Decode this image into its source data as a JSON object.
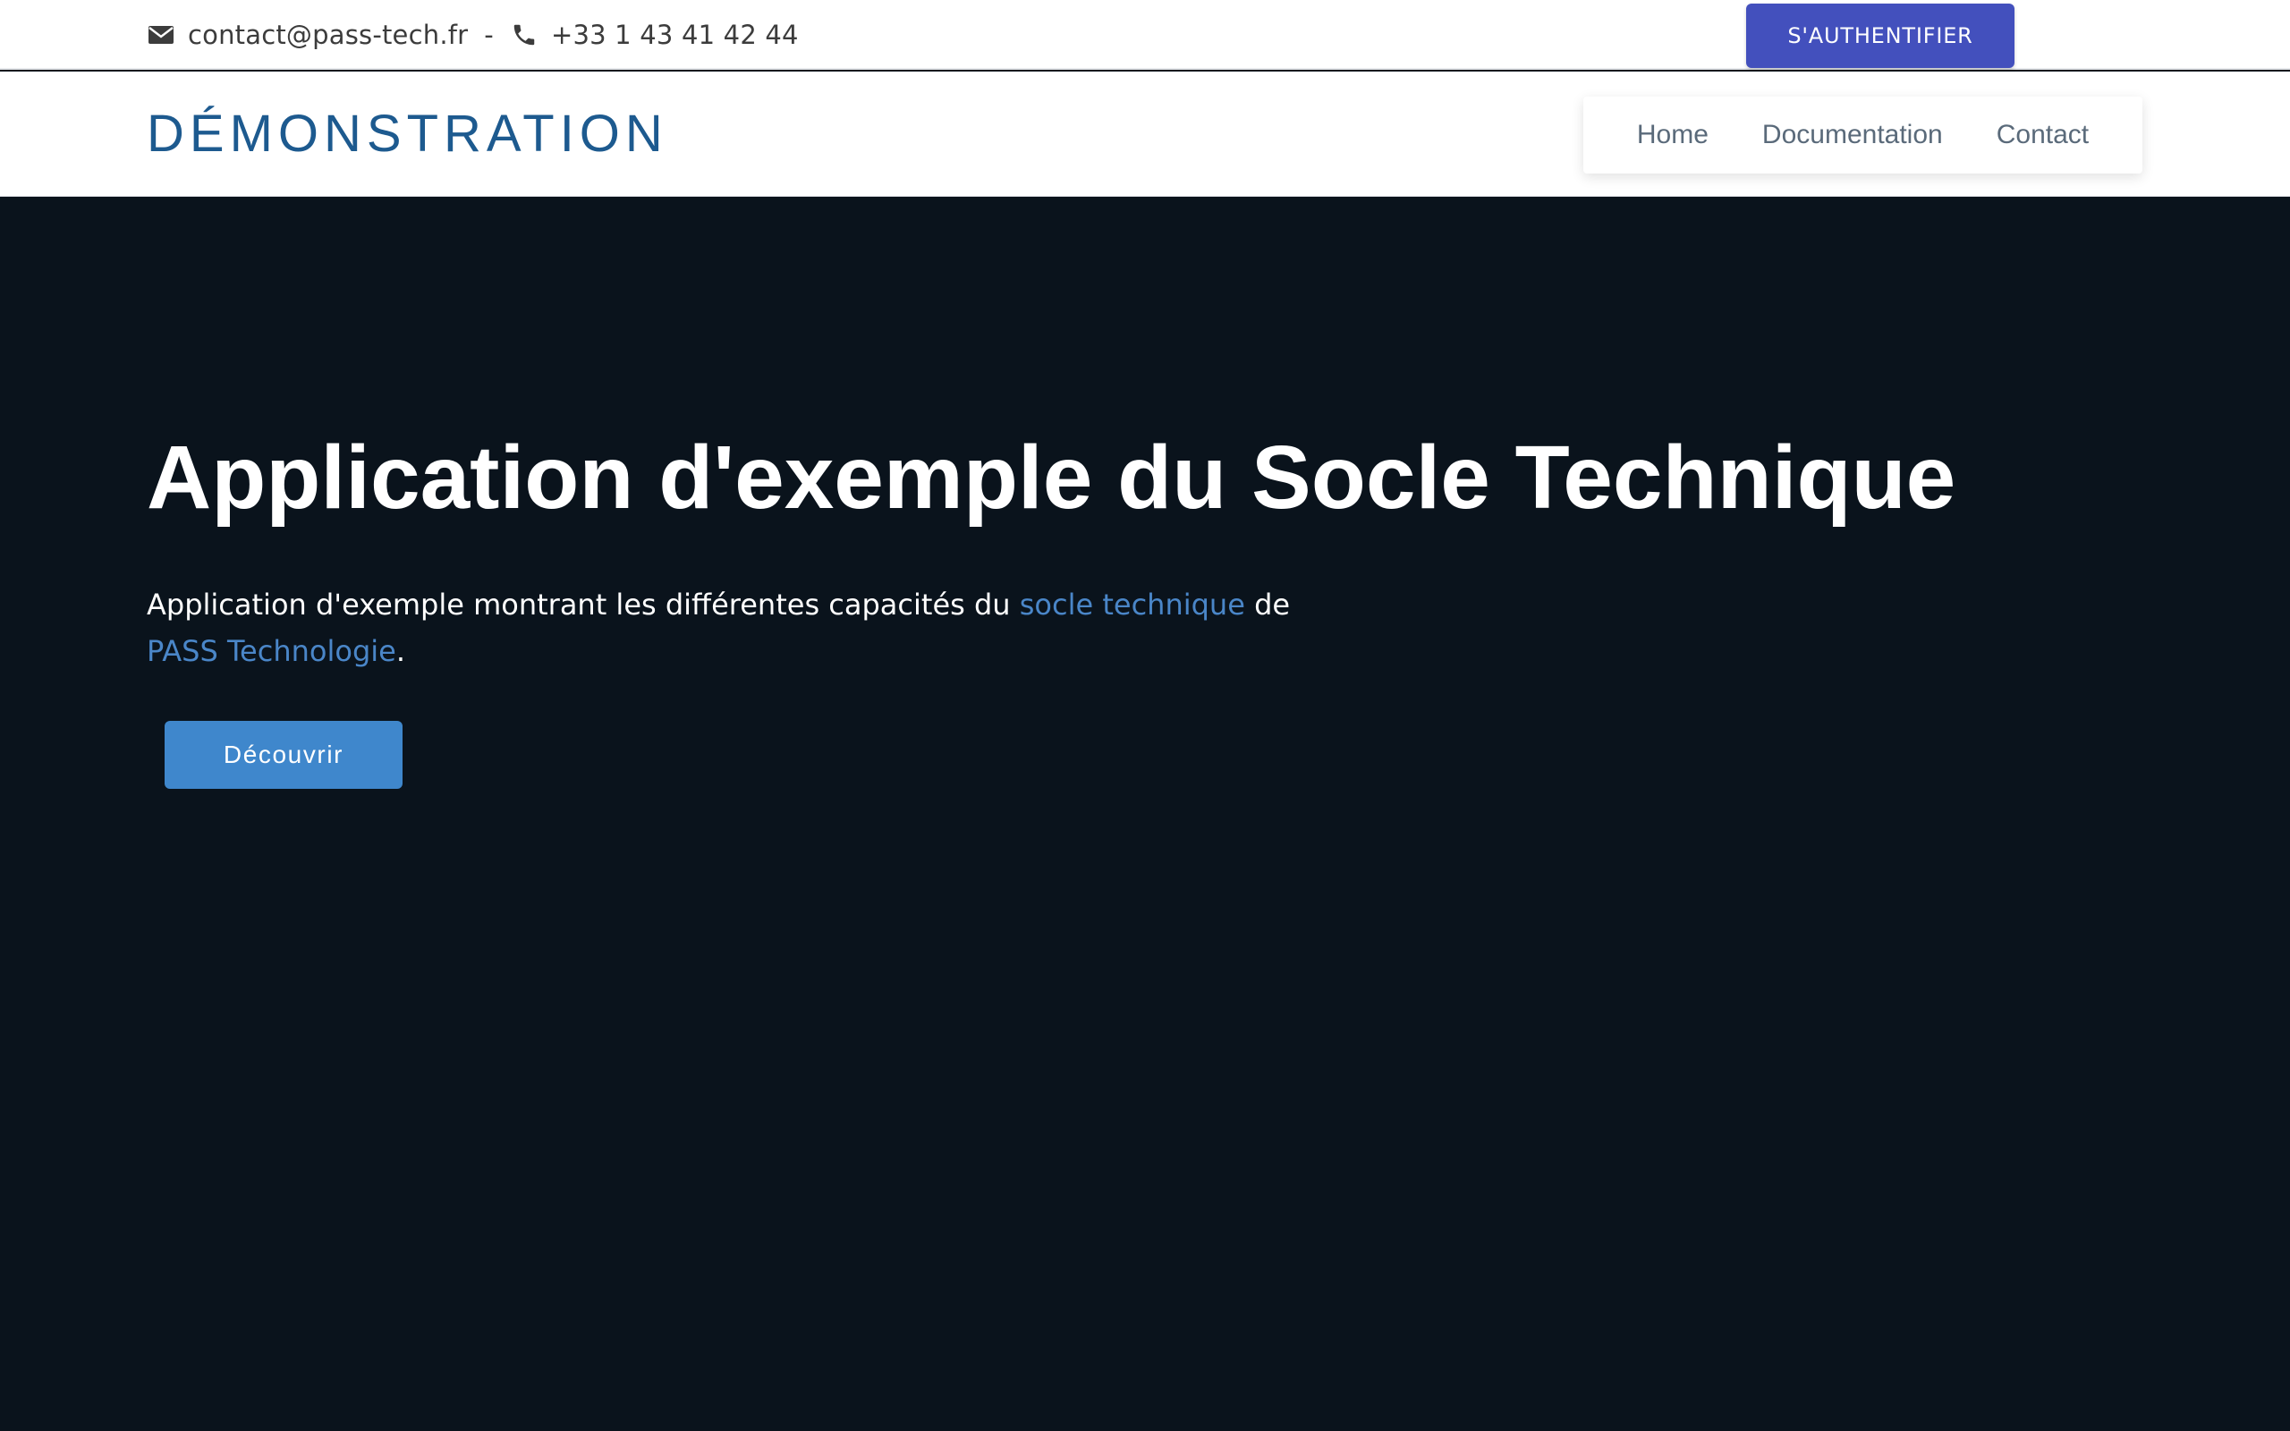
{
  "topbar": {
    "email": "contact@pass-tech.fr",
    "separator": "-",
    "phone": "+33 1 43 41 42 44",
    "email_icon": "envelope-icon",
    "phone_icon": "phone-icon",
    "login_label": "S'AUTHENTIFIER"
  },
  "header": {
    "brand": "DÉMONSTRATION",
    "nav": [
      {
        "label": "Home"
      },
      {
        "label": "Documentation"
      },
      {
        "label": "Contact"
      }
    ]
  },
  "hero": {
    "title": "Application d'exemple du Socle Technique",
    "desc_prefix": "Application d'exemple montrant les différentes capacités du ",
    "desc_link1": "socle technique",
    "desc_middle": " de",
    "desc_link2": "PASS Technologie",
    "desc_suffix": ".",
    "button_label": "Découvrir"
  },
  "colors": {
    "brand": "#1d5a8f",
    "login_button": "#4350bd",
    "hero_background": "#0a131c",
    "link": "#4a86c8",
    "primary_button": "#3f87cc"
  }
}
